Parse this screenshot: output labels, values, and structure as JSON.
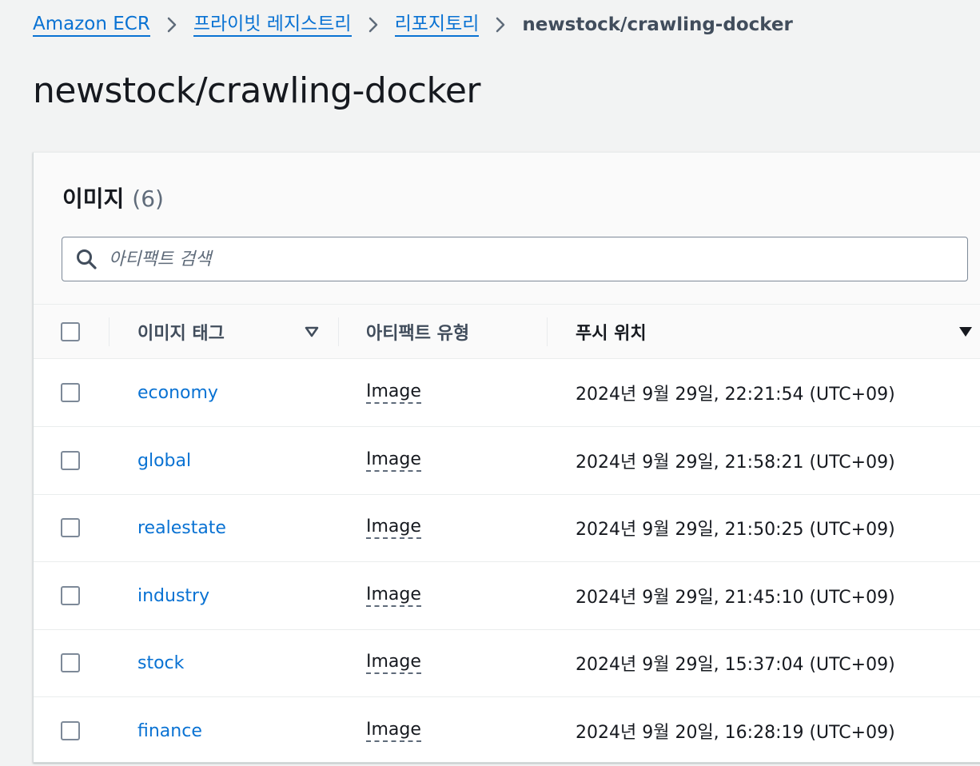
{
  "breadcrumb": {
    "items": [
      "Amazon ECR",
      "프라이빗 레지스트리",
      "리포지토리"
    ],
    "current": "newstock/crawling-docker"
  },
  "page": {
    "title": "newstock/crawling-docker"
  },
  "images_panel": {
    "title": "이미지",
    "count": "(6)",
    "search": {
      "placeholder": "아티팩트 검색",
      "value": ""
    },
    "columns": {
      "tag": "이미지 태그",
      "artifact_type": "아티팩트 유형",
      "pushed_at": "푸시 위치"
    },
    "rows": [
      {
        "tag": "economy",
        "type": "Image",
        "pushed_at": "2024년 9월 29일, 22:21:54 (UTC+09)"
      },
      {
        "tag": "global",
        "type": "Image",
        "pushed_at": "2024년 9월 29일, 21:58:21 (UTC+09)"
      },
      {
        "tag": "realestate",
        "type": "Image",
        "pushed_at": "2024년 9월 29일, 21:50:25 (UTC+09)"
      },
      {
        "tag": "industry",
        "type": "Image",
        "pushed_at": "2024년 9월 29일, 21:45:10 (UTC+09)"
      },
      {
        "tag": "stock",
        "type": "Image",
        "pushed_at": "2024년 9월 29일, 15:37:04 (UTC+09)"
      },
      {
        "tag": "finance",
        "type": "Image",
        "pushed_at": "2024년 9월 20일, 16:28:19 (UTC+09)"
      }
    ]
  },
  "icons": {
    "breadcrumb_separator": "chevron-right-icon",
    "search": "search-icon",
    "sort_tag": "sort-caret-outline-icon",
    "sort_pushed": "sort-caret-filled-icon"
  },
  "colors": {
    "link": "#0972d3",
    "background": "#f2f3f3",
    "text": "#16191f"
  }
}
